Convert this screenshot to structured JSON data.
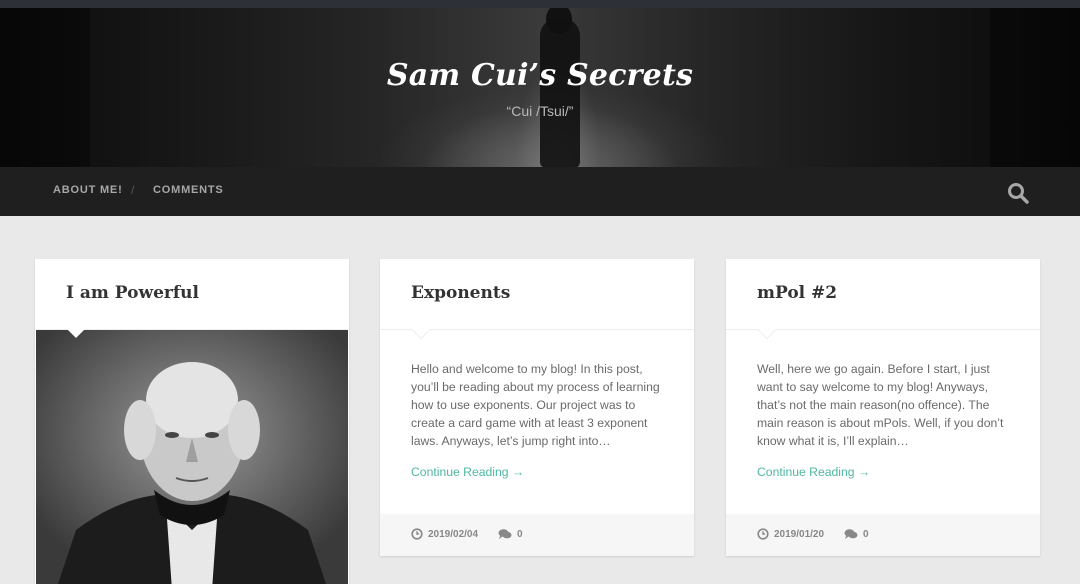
{
  "site": {
    "title": "Sam Cui’s Secrets",
    "tagline": "“Cui /Tsui/”"
  },
  "nav": {
    "items": [
      {
        "label": "About Me!"
      },
      {
        "label": "Comments"
      }
    ],
    "separator": "/",
    "search_icon": "search-icon"
  },
  "posts": [
    {
      "title": "I am Powerful",
      "image": "portrait-engraving"
    },
    {
      "title": "Exponents",
      "excerpt": "Hello and welcome to my blog! In this post, you’ll be reading about my process of learning how to use exponents. Our project was to create a card game with at least 3 exponent laws. Anyways, let’s jump right into…",
      "continue_label": "Continue Reading →",
      "date": "2019/02/04",
      "comments": "0"
    },
    {
      "title": "mPol #2",
      "excerpt": "Well, here we go again. Before I start, I just want to say welcome to my blog! Anyways, that’s not the main reason(no offence). The main reason is about mPols. Well, if you don’t know what it is, I’ll explain…",
      "continue_label": "Continue Reading →",
      "date": "2019/01/20",
      "comments": "0"
    }
  ],
  "colors": {
    "accent": "#4fb7a3",
    "navbar": "#1f1f1f",
    "background": "#e9e9e9"
  }
}
